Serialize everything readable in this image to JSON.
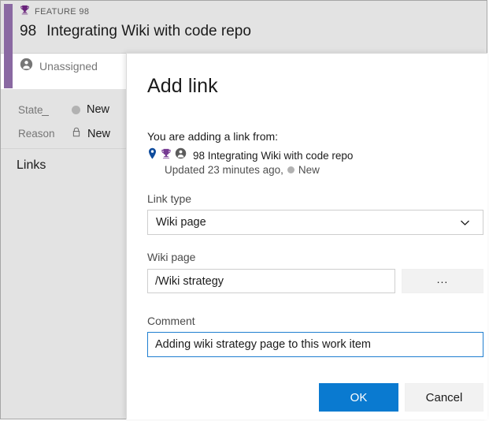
{
  "work_item": {
    "type_label": "FEATURE 98",
    "type_icon": "trophy-icon",
    "id": "98",
    "title": "Integrating Wiki with code repo",
    "assigned_to": "Unassigned",
    "assigned_icon": "person-avatar-icon",
    "accent_color": "#8a69a2",
    "fields": [
      {
        "label": "State",
        "value": "New",
        "icon": "status-dot-icon"
      },
      {
        "label": "Reason",
        "value": "New",
        "icon": "lock-icon"
      }
    ],
    "links_section_title": "Links"
  },
  "dialog": {
    "title": "Add link",
    "from_label": "You are adding a link from:",
    "from_item": {
      "icons": [
        "location-pin-icon",
        "trophy-icon",
        "person-avatar-icon"
      ],
      "text": "98 Integrating Wiki with code repo",
      "updated": "Updated 23 minutes ago,",
      "state": "New"
    },
    "link_type": {
      "label": "Link type",
      "selected": "Wiki page",
      "chevron_icon": "chevron-down-icon"
    },
    "wiki_page": {
      "label": "Wiki page",
      "value": "/Wiki strategy",
      "placeholder": "",
      "browse_label": "..."
    },
    "comment": {
      "label": "Comment",
      "value": "Adding wiki strategy page to this work item",
      "placeholder": ""
    },
    "buttons": {
      "ok": "OK",
      "cancel": "Cancel"
    },
    "accent_color": "#0a7ad0"
  }
}
